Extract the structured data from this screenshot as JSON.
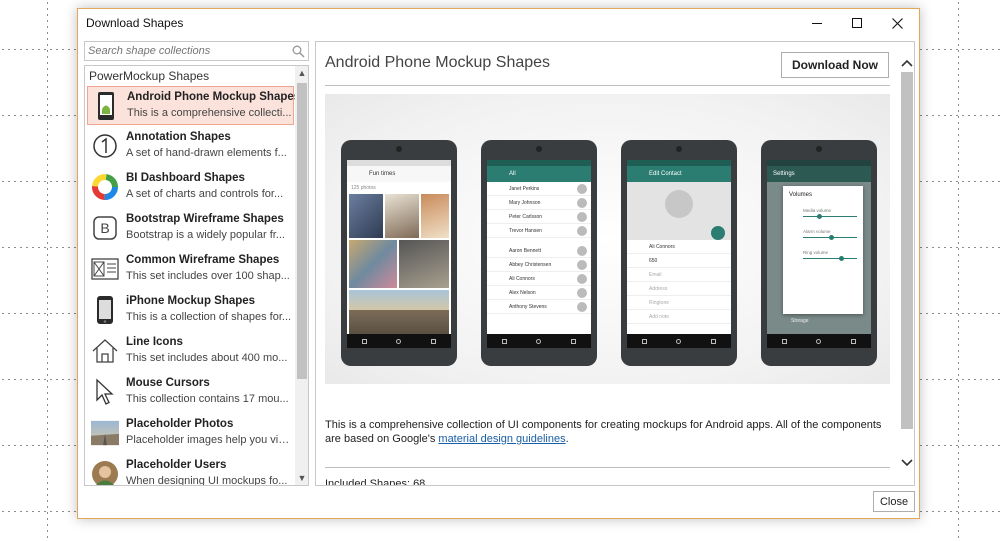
{
  "window": {
    "title": "Download Shapes"
  },
  "search": {
    "placeholder": "Search shape collections"
  },
  "list": {
    "group": "PowerMockup Shapes",
    "items": [
      {
        "name": "Android Phone Mockup Shapes",
        "desc": "This is a comprehensive collecti...",
        "icon": "android-phone-icon"
      },
      {
        "name": "Annotation Shapes",
        "desc": "A set of hand-drawn elements f...",
        "icon": "annotation-icon"
      },
      {
        "name": "BI Dashboard Shapes",
        "desc": "A set of charts and controls for...",
        "icon": "donut-chart-icon"
      },
      {
        "name": "Bootstrap Wireframe Shapes",
        "desc": "Bootstrap is a widely popular fr...",
        "icon": "bootstrap-icon"
      },
      {
        "name": "Common Wireframe Shapes",
        "desc": "This set includes over 100 shap...",
        "icon": "wireframe-icon"
      },
      {
        "name": "iPhone Mockup Shapes",
        "desc": "This is a collection of shapes for...",
        "icon": "iphone-icon"
      },
      {
        "name": "Line Icons",
        "desc": "This set includes about 400 mo...",
        "icon": "house-line-icon"
      },
      {
        "name": "Mouse Cursors",
        "desc": "This collection contains 17 mou...",
        "icon": "cursor-icon"
      },
      {
        "name": "Placeholder Photos",
        "desc": "Placeholder images help you vis...",
        "icon": "photo-icon"
      },
      {
        "name": "Placeholder Users",
        "desc": "When designing UI mockups fo...",
        "icon": "user-avatar-icon"
      }
    ]
  },
  "detail": {
    "title": "Android Phone Mockup Shapes",
    "download_label": "Download Now",
    "description_before": "This is a comprehensive collection of UI components for creating mockups for Android apps. All of the components are based on Google's ",
    "link_text": "material design guidelines",
    "description_after": ".",
    "included": "Included Shapes: 68"
  },
  "phones": {
    "p1_title": "Fun times",
    "p1_count": "125 photos",
    "p2_title": "All",
    "p2_contacts": [
      "Janet Perkins",
      "Mary Johnson",
      "Peter Carlsson",
      "Trevor Hansen",
      "Aaron Bennett",
      "Abbey Christensen",
      "Ali Connors",
      "Alex Nelson",
      "Anthony Stevens"
    ],
    "p3_title": "Edit Contact",
    "p3_fields": [
      "Ali Connors",
      "650",
      "Email",
      "Address",
      "Ringtone",
      "Add note"
    ],
    "p4_title": "Settings",
    "p4_dialog": "Volumes",
    "p4_labels": [
      "Media volume",
      "Alarm volume",
      "Ring volume"
    ],
    "p4_footer": "Storage"
  },
  "footer": {
    "close_label": "Close"
  }
}
